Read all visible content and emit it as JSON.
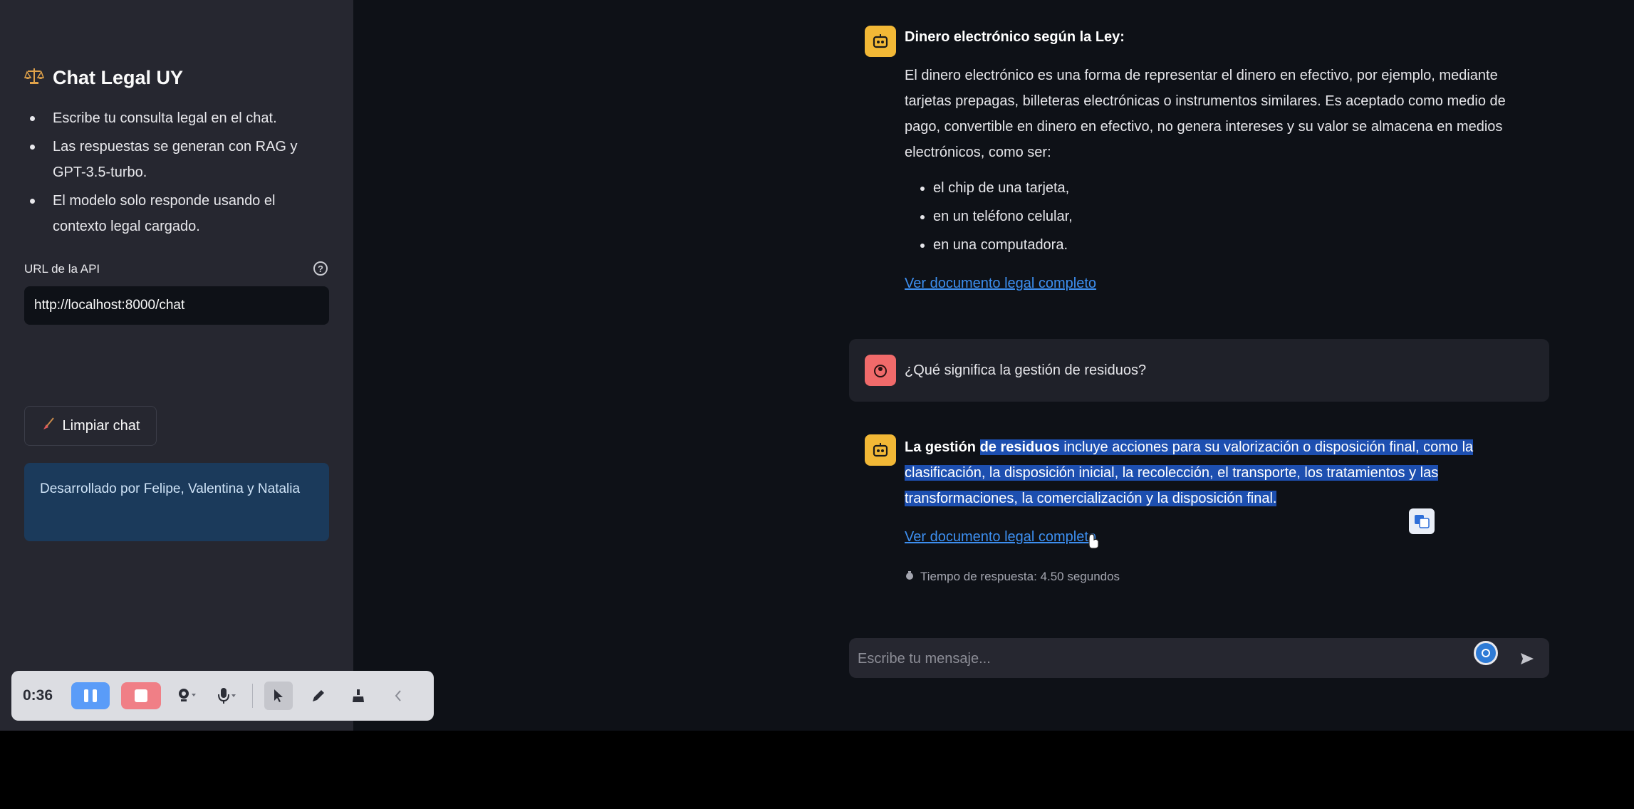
{
  "sidebar": {
    "title": "Chat Legal UY",
    "title_icon": "scales-icon",
    "bullets": [
      "Escribe tu consulta legal en el chat.",
      "Las respuestas se generan con RAG y GPT-3.5-turbo.",
      "El modelo solo responde usando el contexto legal cargado."
    ],
    "api_label": "URL de la API",
    "api_value": "http://localhost:8000/chat",
    "clear_label": "Limpiar chat",
    "info": "Desarrollado por Felipe, Valentina y Natalia"
  },
  "chat": {
    "msg1": {
      "heading": "Dinero electrónico según la Ley:",
      "body": "El dinero electrónico es una forma de representar el dinero en efectivo, por ejemplo, mediante tarjetas prepagas, billeteras electrónicas o instrumentos similares. Es aceptado como medio de pago, convertible en dinero en efectivo, no genera intereses y su valor se almacena en medios electrónicos, como ser:",
      "items": [
        "el chip de una tarjeta,",
        "en un teléfono celular,",
        "en una computadora."
      ],
      "link": "Ver documento legal completo"
    },
    "user_msg": "¿Qué significa la gestión de residuos?",
    "msg2": {
      "bold_a": "La gestión",
      "bold_b": "de residuos",
      "text": "incluye acciones para su valorización o disposición final, como la clasificación, la disposición inicial, la recolección, el transporte, los tratamientos y las transformaciones, la comercialización y la disposición final.",
      "link": "Ver documento legal completo"
    },
    "timing": "Tiempo de respuesta: 4.50 segundos",
    "input_placeholder": "Escribe tu mensaje..."
  },
  "recorder": {
    "time": "0:36"
  },
  "colors": {
    "sidebar_bg": "#262730",
    "main_bg": "#0e1117",
    "bot_avatar": "#f2b836",
    "user_avatar": "#f06a6a",
    "link": "#3d8ff0",
    "selection": "#1d4fb0"
  }
}
